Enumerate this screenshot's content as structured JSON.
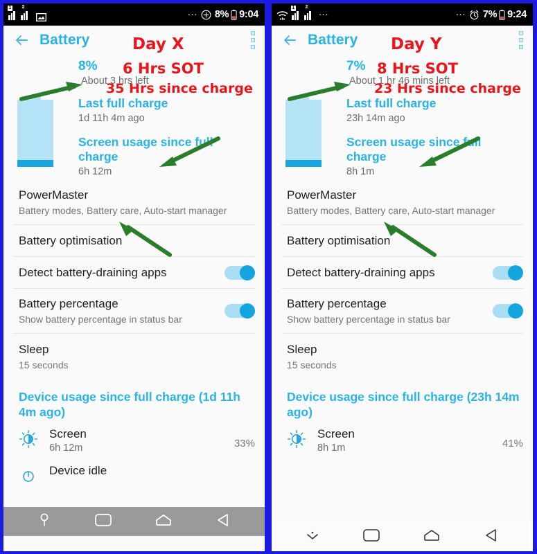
{
  "theme": {
    "frame_blue": "#1a1ae0",
    "accent_cyan": "#29b2e6",
    "annotation_red": "#e8151c",
    "arrow_green": "#2a7d2a",
    "bg": "#fafafa"
  },
  "panels": [
    {
      "id": "left",
      "statusbar": {
        "icons_left": [
          "sim1-signal-icon",
          "sim2-signal-icon",
          "screenshot-icon"
        ],
        "dots": "...",
        "right_icon": "add-circle-icon",
        "battery_percent": "8%",
        "battery_icon": "battery-icon",
        "clock": "9:04"
      },
      "header": {
        "back_icon": "back-arrow-icon",
        "title": "Battery",
        "overflow_icon": "overflow-menu-icon"
      },
      "annotations": {
        "day": "Day X",
        "sot": "6 Hrs SOT",
        "since_charge": "35 Hrs since charge",
        "arrow_icon": "green-arrow-icon"
      },
      "summary": {
        "percent": "8%",
        "time_left": "About 3 hrs left",
        "battery_glyph": "battery-level-icon"
      },
      "charge": {
        "last_full_charge_label": "Last full charge",
        "last_full_charge_value": "1d 11h 4m ago",
        "screen_usage_label": "Screen usage since full charge",
        "screen_usage_value": "6h 12m"
      },
      "settings": [
        {
          "name": "powermaster",
          "title": "PowerMaster",
          "subtitle": "Battery modes, Battery care, Auto-start manager",
          "toggle": null
        },
        {
          "name": "battery-optimisation",
          "title": "Battery optimisation",
          "subtitle": "",
          "toggle": null
        },
        {
          "name": "detect-battery-draining-apps",
          "title": "Detect battery-draining apps",
          "subtitle": "",
          "toggle": "on"
        },
        {
          "name": "battery-percentage",
          "title": "Battery percentage",
          "subtitle": "Show battery percentage in status bar",
          "toggle": "on"
        },
        {
          "name": "sleep",
          "title": "Sleep",
          "subtitle": "15 seconds",
          "toggle": null
        }
      ],
      "usage": {
        "heading": "Device usage since full charge (1d 11h 4m ago)",
        "items": [
          {
            "icon": "brightness-icon",
            "name": "Screen",
            "time": "6h 12m",
            "percent": "33%"
          },
          {
            "icon": "device-idle-icon",
            "name": "Device idle",
            "time": "",
            "percent": ""
          }
        ]
      },
      "navbar": {
        "style": "overlay-gray",
        "buttons": [
          "location-pin-icon",
          "recents-icon",
          "home-icon",
          "back-icon"
        ]
      }
    },
    {
      "id": "right",
      "statusbar": {
        "icons_left": [
          "wifi-icon",
          "sim1-signal-icon",
          "sim2-signal-icon",
          "more-dots-icon"
        ],
        "dots": "...",
        "right_icon": "alarm-clock-icon",
        "battery_percent": "7%",
        "battery_icon": "battery-icon",
        "clock": "9:24"
      },
      "header": {
        "back_icon": "back-arrow-icon",
        "title": "Battery",
        "overflow_icon": "overflow-menu-icon"
      },
      "annotations": {
        "day": "Day Y",
        "sot": "8 Hrs SOT",
        "since_charge": "23 Hrs since charge",
        "arrow_icon": "green-arrow-icon"
      },
      "summary": {
        "percent": "7%",
        "time_left": "About 1 hr 46 mins left",
        "battery_glyph": "battery-level-icon"
      },
      "charge": {
        "last_full_charge_label": "Last full charge",
        "last_full_charge_value": "23h 14m ago",
        "screen_usage_label": "Screen usage since full charge",
        "screen_usage_value": "8h 1m"
      },
      "settings": [
        {
          "name": "powermaster",
          "title": "PowerMaster",
          "subtitle": "Battery modes, Battery care, Auto-start manager",
          "toggle": null
        },
        {
          "name": "battery-optimisation",
          "title": "Battery optimisation",
          "subtitle": "",
          "toggle": null
        },
        {
          "name": "detect-battery-draining-apps",
          "title": "Detect battery-draining apps",
          "subtitle": "",
          "toggle": "on"
        },
        {
          "name": "battery-percentage",
          "title": "Battery percentage",
          "subtitle": "Show battery percentage in status bar",
          "toggle": "on"
        },
        {
          "name": "sleep",
          "title": "Sleep",
          "subtitle": "15 seconds",
          "toggle": null
        }
      ],
      "usage": {
        "heading": "Device usage since full charge (23h 14m ago)",
        "items": [
          {
            "icon": "brightness-icon",
            "name": "Screen",
            "time": "8h 1m",
            "percent": "41%"
          }
        ]
      },
      "navbar": {
        "style": "solid-white",
        "buttons": [
          "collapse-icon",
          "recents-icon",
          "home-icon",
          "back-icon"
        ]
      }
    }
  ]
}
